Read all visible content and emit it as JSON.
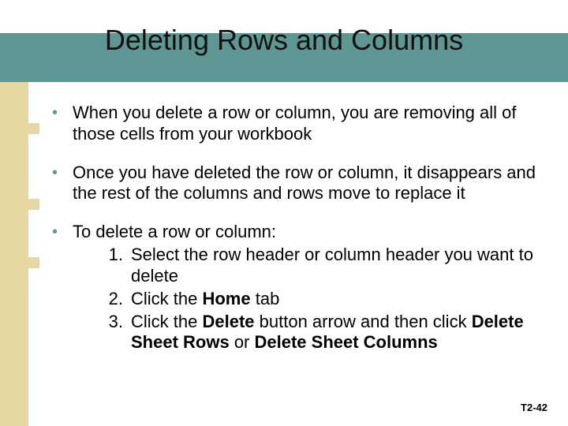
{
  "title": "Deleting Rows and Columns",
  "bullets": {
    "b1": "When you delete a row or column, you are removing all of those cells from your workbook",
    "b2": "Once you have deleted the row or column, it disappears and the rest of the columns and rows move to replace it",
    "b3_lead": "To delete a row or column:",
    "steps": {
      "s1": "Select the row header or column header you want to delete",
      "s2_pre": "Click the ",
      "s2_b1": "Home",
      "s2_post": " tab",
      "s3_pre": "Click the ",
      "s3_b1": "Delete",
      "s3_mid": " button arrow and then click ",
      "s3_b2": "Delete Sheet Rows",
      "s3_mid2": " or ",
      "s3_b3": "Delete Sheet Columns"
    },
    "nums": {
      "n1": "1.",
      "n2": "2.",
      "n3": "3."
    }
  },
  "bullet_dot": "•",
  "footer": "T2-42"
}
